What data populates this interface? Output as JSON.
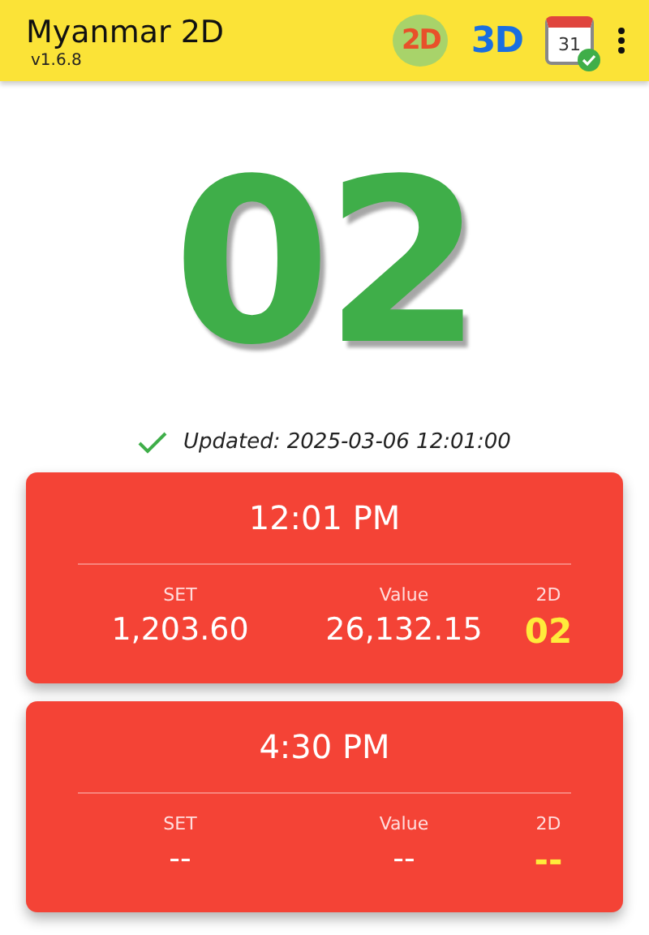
{
  "app_bar": {
    "title": "Myanmar 2D",
    "version": "v1.6.8",
    "actions": [
      {
        "kind": "twod",
        "label": "2D"
      },
      {
        "kind": "threed",
        "label": "3D"
      },
      {
        "kind": "calendar",
        "label": "31"
      },
      {
        "kind": "more"
      }
    ]
  },
  "result": "02",
  "updated": "Updated: 2025-03-06 12:01:00",
  "sessions": [
    {
      "time": "12:01 PM",
      "set_label": "SET",
      "set": "1,203.60",
      "value_label": "Value",
      "value": "26,132.15",
      "twod_label": "2D",
      "twod": "02"
    },
    {
      "time": "4:30 PM",
      "set_label": "SET",
      "set": "--",
      "value_label": "Value",
      "value": "--",
      "twod_label": "2D",
      "twod": "--"
    }
  ]
}
